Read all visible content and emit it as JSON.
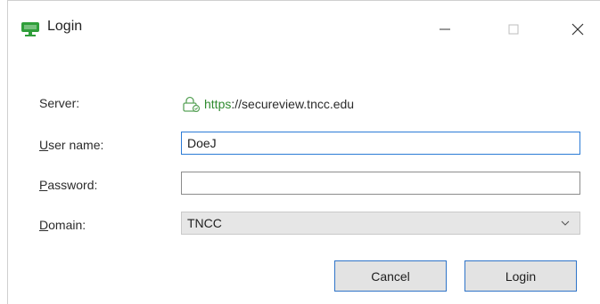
{
  "window": {
    "title": "Login",
    "controls": {
      "minimize_icon": "minimize-icon",
      "maximize_icon": "maximize-icon",
      "close_icon": "close-icon"
    }
  },
  "form": {
    "server": {
      "label": "Server:",
      "scheme": "https",
      "rest": "://secureview.tncc.edu",
      "icon": "lock-icon"
    },
    "username": {
      "label_accel": "U",
      "label_rest": "ser name:",
      "value": "DoeJ"
    },
    "password": {
      "label_accel": "P",
      "label_rest": "assword:",
      "value": ""
    },
    "domain": {
      "label_accel": "D",
      "label_rest": "omain:",
      "selected": "TNCC"
    }
  },
  "buttons": {
    "cancel": "Cancel",
    "login": "Login"
  },
  "colors": {
    "accent": "#2f74c8",
    "focus_border": "#2b7bd6",
    "brand_green": "#2f8a2f",
    "button_bg": "#e3e3e3"
  }
}
